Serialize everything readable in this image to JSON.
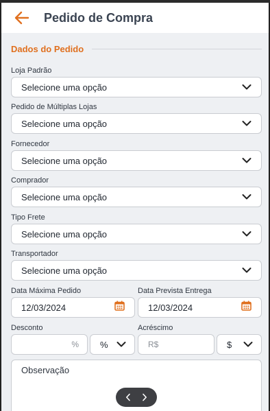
{
  "header": {
    "title": "Pedido de Compra",
    "back_icon": "arrow-left-icon",
    "accent": "#e0701f"
  },
  "section": {
    "title": "Dados do Pedido"
  },
  "fields": [
    {
      "label": "Loja Padrão",
      "value": "Selecione uma opção"
    },
    {
      "label": "Pedido de Múltiplas Lojas",
      "value": "Selecione uma opção"
    },
    {
      "label": "Fornecedor",
      "value": "Selecione uma opção"
    },
    {
      "label": "Comprador",
      "value": "Selecione uma opção"
    },
    {
      "label": "Tipo Frete",
      "value": "Selecione uma opção"
    },
    {
      "label": "Transportador",
      "value": "Selecione uma opção"
    }
  ],
  "dates": {
    "max": {
      "label": "Data Máxima Pedido",
      "value": "12/03/2024"
    },
    "expected": {
      "label": "Data Prevista Entrega",
      "value": "12/03/2024"
    }
  },
  "discount": {
    "label": "Desconto",
    "suffix": "%",
    "type_value": "%"
  },
  "addition": {
    "label": "Acréscimo",
    "placeholder": "R$",
    "type_value": "$"
  },
  "observation": {
    "placeholder": "Observação"
  },
  "pager": {
    "prev_icon": "chevron-left-icon",
    "next_icon": "chevron-right-icon"
  }
}
